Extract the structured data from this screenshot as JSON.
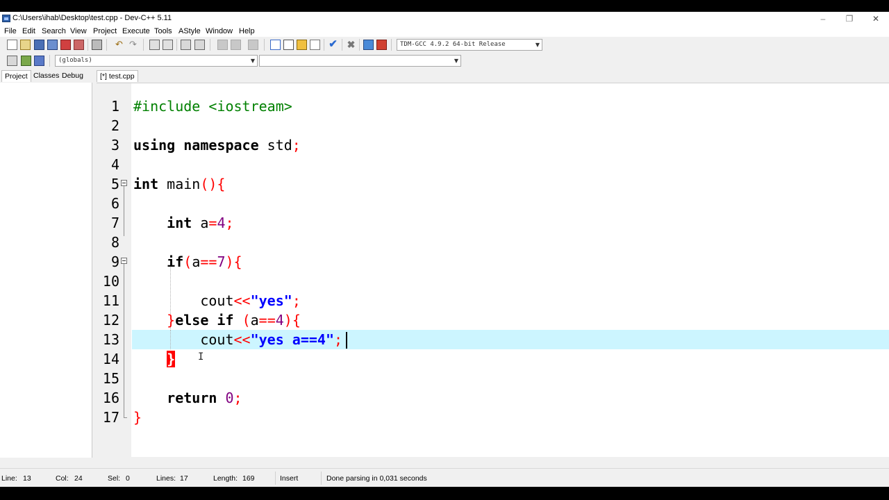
{
  "window": {
    "title": "C:\\Users\\ihab\\Desktop\\test.cpp - Dev-C++ 5.11",
    "controls": [
      "–",
      "❐",
      "✕"
    ]
  },
  "menu": [
    "File",
    "Edit",
    "Search",
    "View",
    "Project",
    "Execute",
    "Tools",
    "AStyle",
    "Window",
    "Help"
  ],
  "toolbar": {
    "compiler": "TDM-GCC 4.9.2 64-bit Release",
    "scope": "(globals)",
    "members": ""
  },
  "left_tabs": [
    "Project",
    "Classes",
    "Debug"
  ],
  "editor_tab": "[*] test.cpp",
  "code": {
    "line_numbers": [
      "1",
      "2",
      "3",
      "4",
      "5",
      "6",
      "7",
      "8",
      "9",
      "10",
      "11",
      "12",
      "13",
      "14",
      "15",
      "16",
      "17"
    ],
    "current_line": 13
  },
  "status": {
    "line_label": "Line:",
    "line_value": "13",
    "col_label": "Col:",
    "col_value": "24",
    "sel_label": "Sel:",
    "sel_value": "0",
    "lines_label": "Lines:",
    "lines_value": "17",
    "length_label": "Length:",
    "length_value": "169",
    "mode": "Insert",
    "message": "Done parsing in 0,031 seconds"
  },
  "colors": {
    "current_line": "#ccf5ff",
    "keyword": "#000000",
    "preprocessor": "#008000",
    "number": "#800080",
    "string": "#0000ff",
    "symbol": "#ff0000",
    "brace_match": "#ff0000"
  }
}
